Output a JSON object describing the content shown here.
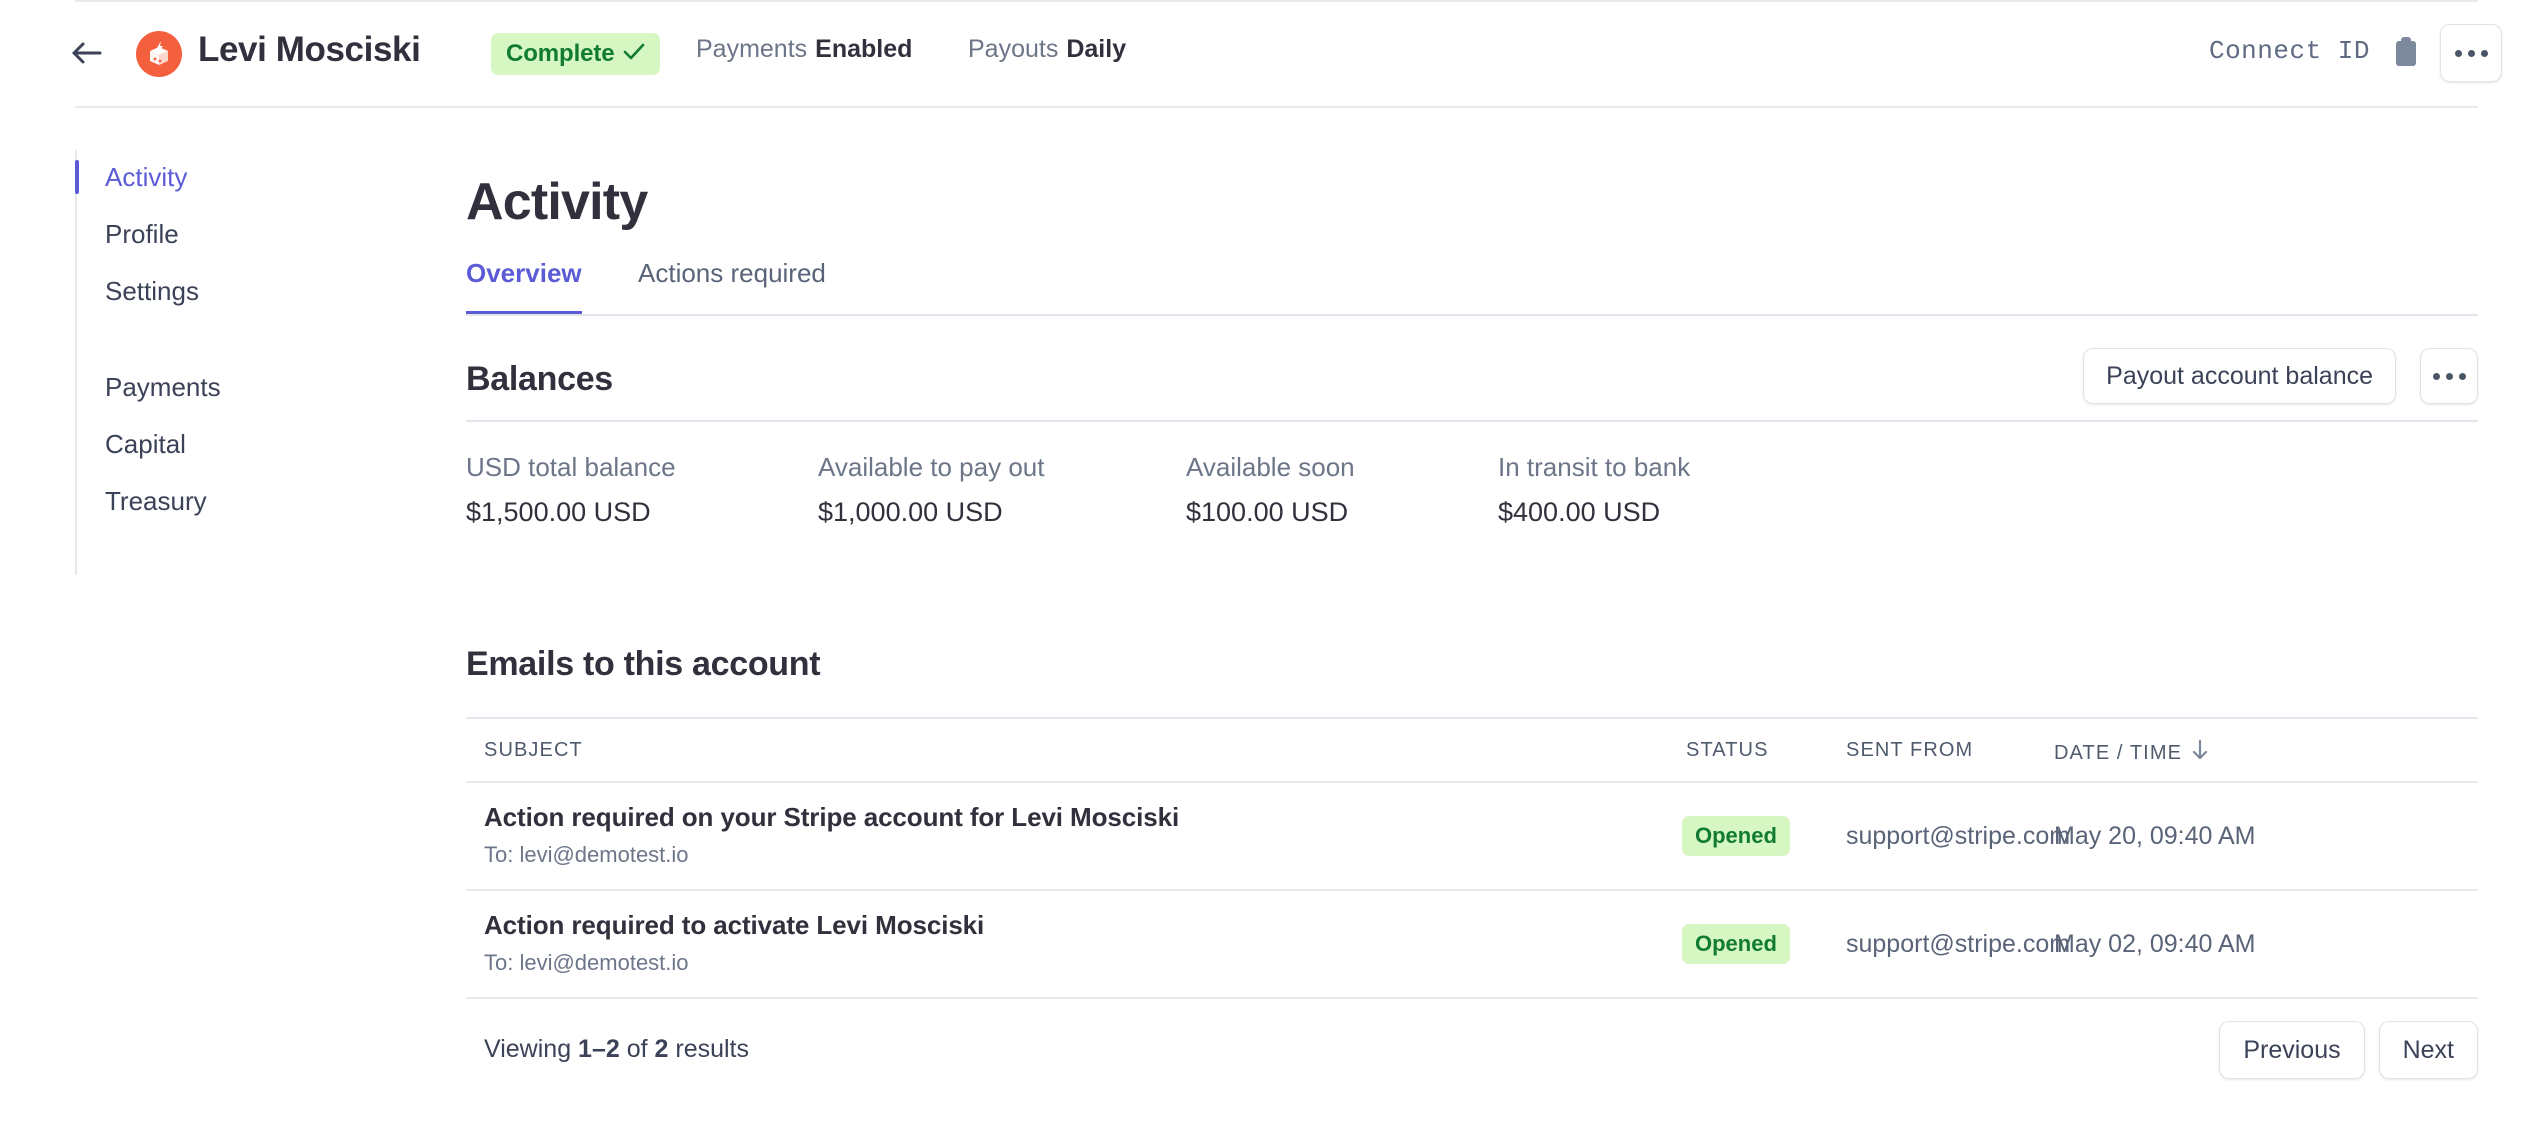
{
  "header": {
    "back_icon": "arrow-left-icon",
    "avatar_icon": "stripe-box-logo-icon",
    "avatar_color": "#f4603e",
    "account_name": "Levi Mosciski",
    "status_badge": {
      "label": "Complete",
      "icon": "check-icon",
      "bg": "#d7f7c2",
      "fg": "#117b34"
    },
    "meta": [
      {
        "label": "Payments",
        "value": "Enabled"
      },
      {
        "label": "Payouts",
        "value": "Daily"
      }
    ],
    "connect_id_label": "Connect ID",
    "copy_icon": "clipboard-copy-icon",
    "overflow_icon": "ellipsis-horizontal-icon"
  },
  "sidebar": {
    "items": [
      {
        "label": "Activity",
        "active": true
      },
      {
        "label": "Profile",
        "active": false
      },
      {
        "label": "Settings",
        "active": false
      },
      {
        "label": "Payments",
        "active": false
      },
      {
        "label": "Capital",
        "active": false
      },
      {
        "label": "Treasury",
        "active": false
      }
    ],
    "active_color": "#5b5bd6"
  },
  "main": {
    "page_title": "Activity",
    "tabs": [
      {
        "label": "Overview",
        "active": true
      },
      {
        "label": "Actions required",
        "active": false
      }
    ],
    "balances": {
      "heading": "Balances",
      "payout_button_label": "Payout account balance",
      "overflow_icon": "ellipsis-horizontal-icon",
      "columns": [
        {
          "label": "USD total balance",
          "value": "$1,500.00 USD"
        },
        {
          "label": "Available to pay out",
          "value": "$1,000.00 USD"
        },
        {
          "label": "Available soon",
          "value": "$100.00 USD"
        },
        {
          "label": "In transit to bank",
          "value": "$400.00 USD"
        }
      ]
    },
    "emails": {
      "heading": "Emails to this account",
      "columns": {
        "subject": "SUBJECT",
        "status": "STATUS",
        "sent_from": "SENT FROM",
        "date_time": "DATE / TIME",
        "sort_icon": "arrow-down-icon"
      },
      "rows": [
        {
          "subject": "Action required on your Stripe account for Levi Mosciski",
          "recipient": "To: levi@demotest.io",
          "status": "Opened",
          "sent_from": "support@stripe.com",
          "date_time": "May 20, 09:40 AM"
        },
        {
          "subject": "Action required to activate Levi Mosciski",
          "recipient": "To: levi@demotest.io",
          "status": "Opened",
          "sent_from": "support@stripe.com",
          "date_time": "May 02, 09:40 AM"
        }
      ],
      "footer": {
        "viewing_prefix": "Viewing ",
        "viewing_range": "1–2",
        "viewing_mid": " of ",
        "viewing_total": "2",
        "viewing_suffix": " results",
        "previous_label": "Previous",
        "next_label": "Next"
      }
    }
  }
}
